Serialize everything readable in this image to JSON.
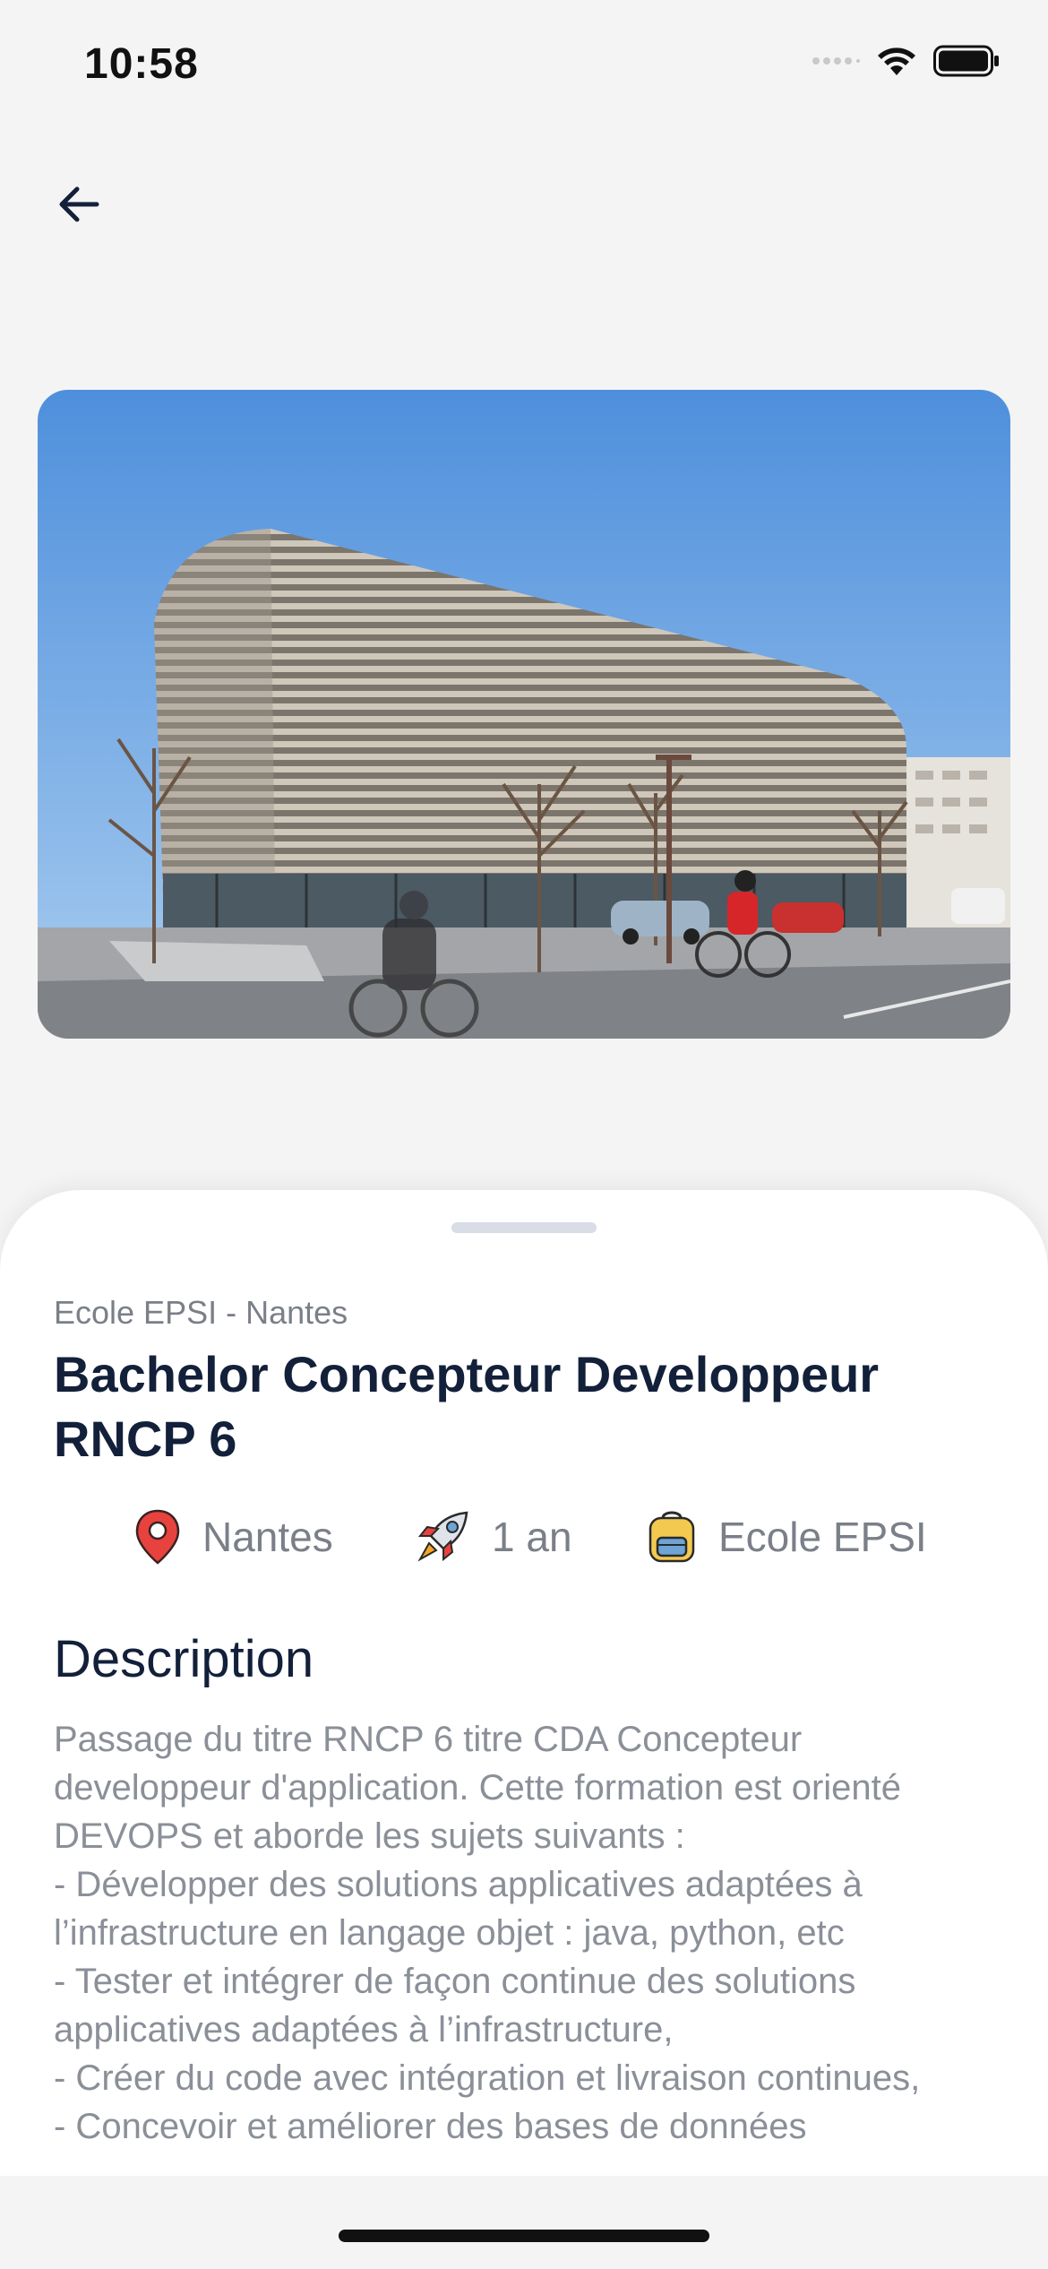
{
  "status_bar": {
    "time": "10:58"
  },
  "header": {
    "back_icon": "arrow-left-icon"
  },
  "hero": {
    "alt": "Photo of the Ecole EPSI building in Nantes"
  },
  "formation": {
    "school_label": "Ecole EPSI - Nantes",
    "title": "Bachelor Concepteur Developpeur RNCP 6",
    "meta": [
      {
        "icon": "location-pin-icon",
        "label": "Nantes"
      },
      {
        "icon": "rocket-icon",
        "label": "1 an"
      },
      {
        "icon": "backpack-icon",
        "label": "Ecole EPSI"
      }
    ],
    "description_heading": "Description",
    "description_text": "Passage du titre RNCP 6 titre CDA Concepteur developpeur d'application. Cette formation est orienté DEVOPS et aborde les sujets suivants :\n- Développer des solutions applicatives adaptées à l’infrastructure en langage objet : java, python, etc\n- Tester et intégrer de façon continue des solutions applicatives adaptées à l’infrastructure,\n- Créer du code avec intégration et livraison continues,\n- Concevoir et améliorer des bases de données"
  },
  "colors": {
    "background": "#f4f4f4",
    "title": "#13203a",
    "muted_text": "#7a7f88",
    "pin_red": "#e8423f"
  }
}
